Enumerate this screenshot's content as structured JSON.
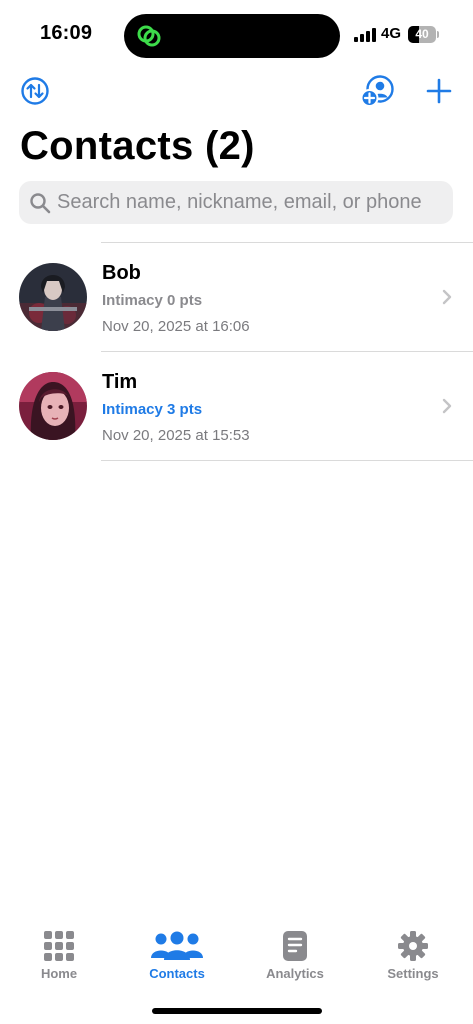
{
  "status_bar": {
    "time": "16:09",
    "network": "4G",
    "battery": "40",
    "battery_level": 0.4
  },
  "header": {
    "title": "Contacts (2)"
  },
  "search": {
    "placeholder": "Search name, nickname, email, or phone"
  },
  "contacts": [
    {
      "name": "Bob",
      "intimacy": "Intimacy 0 pts",
      "date": "Nov 20, 2025 at 16:06"
    },
    {
      "name": "Tim",
      "intimacy": "Intimacy 3 pts",
      "date": "Nov 20, 2025 at 15:53"
    }
  ],
  "tabs": [
    {
      "label": "Home",
      "icon": "grid-icon"
    },
    {
      "label": "Contacts",
      "icon": "people-icon",
      "active": true
    },
    {
      "label": "Analytics",
      "icon": "document-icon"
    },
    {
      "label": "Settings",
      "icon": "gear-icon"
    }
  ],
  "colors": {
    "accent": "#1f7be6",
    "inactive": "#8a8a8e",
    "search_bg": "#efeff0"
  }
}
